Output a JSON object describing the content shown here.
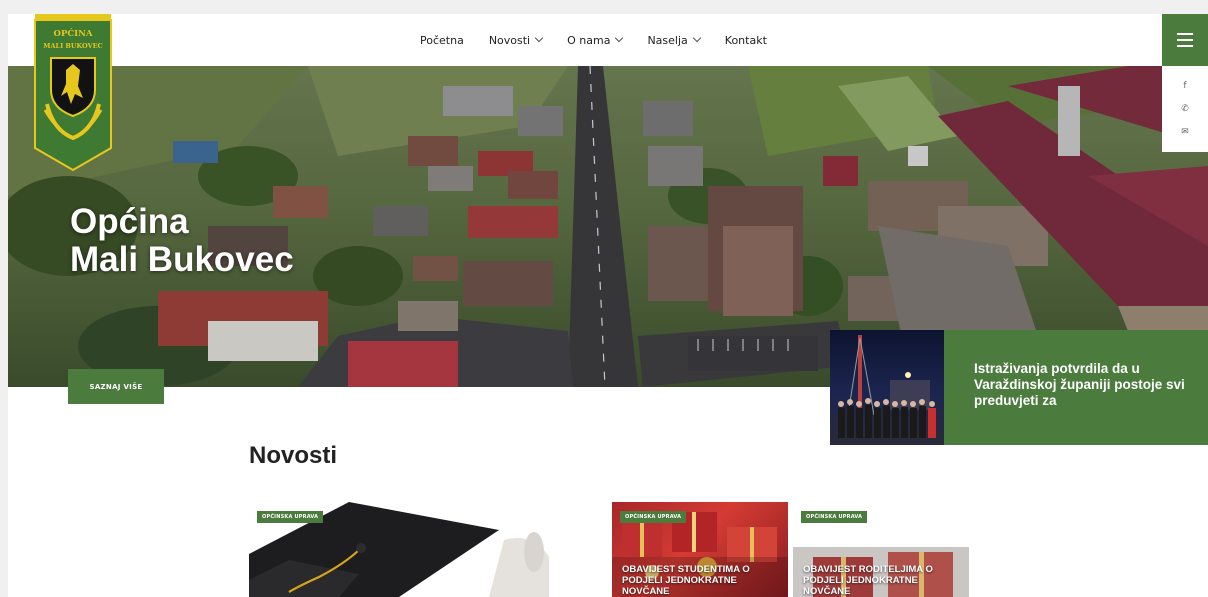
{
  "site": {
    "logo_text_line1": "OPĆINA",
    "logo_text_line2": "MALI BUKOVEC"
  },
  "nav": {
    "items": [
      {
        "label": "Početna",
        "dropdown": false
      },
      {
        "label": "Novosti",
        "dropdown": true
      },
      {
        "label": "O nama",
        "dropdown": true
      },
      {
        "label": "Naselja",
        "dropdown": true
      },
      {
        "label": "Kontakt",
        "dropdown": false
      }
    ]
  },
  "hero": {
    "title_line1": "Općina",
    "title_line2": "Mali Bukovec",
    "cta_label": "SAZNAJ VIŠE"
  },
  "social": {
    "facebook": "f",
    "phone": "✆",
    "email": "✉"
  },
  "slider": {
    "headline": "Istraživanja potvrdila da u Varaždinskoj županiji postoje svi preduvjeti za"
  },
  "news": {
    "section_title": "Novosti",
    "cards": [
      {
        "category": "OPĆINSKA UPRAVA",
        "title": ""
      },
      {
        "category": "OPĆINSKA UPRAVA",
        "title": "OBAVIJEST STUDENTIMA O PODJELI JEDNOKRATNE NOVČANE"
      },
      {
        "category": "OPĆINSKA UPRAVA",
        "title": "OBAVIJEST RODITELJIMA O PODJELI JEDNOKRATNE NOVČANE"
      }
    ]
  },
  "colors": {
    "brand_green": "#4b7b3d",
    "logo_gold": "#e6c71d",
    "logo_green": "#3f7a32"
  },
  "icons": [
    "hamburger-icon",
    "facebook-icon",
    "phone-icon",
    "mail-icon",
    "chevron-down-icon"
  ]
}
